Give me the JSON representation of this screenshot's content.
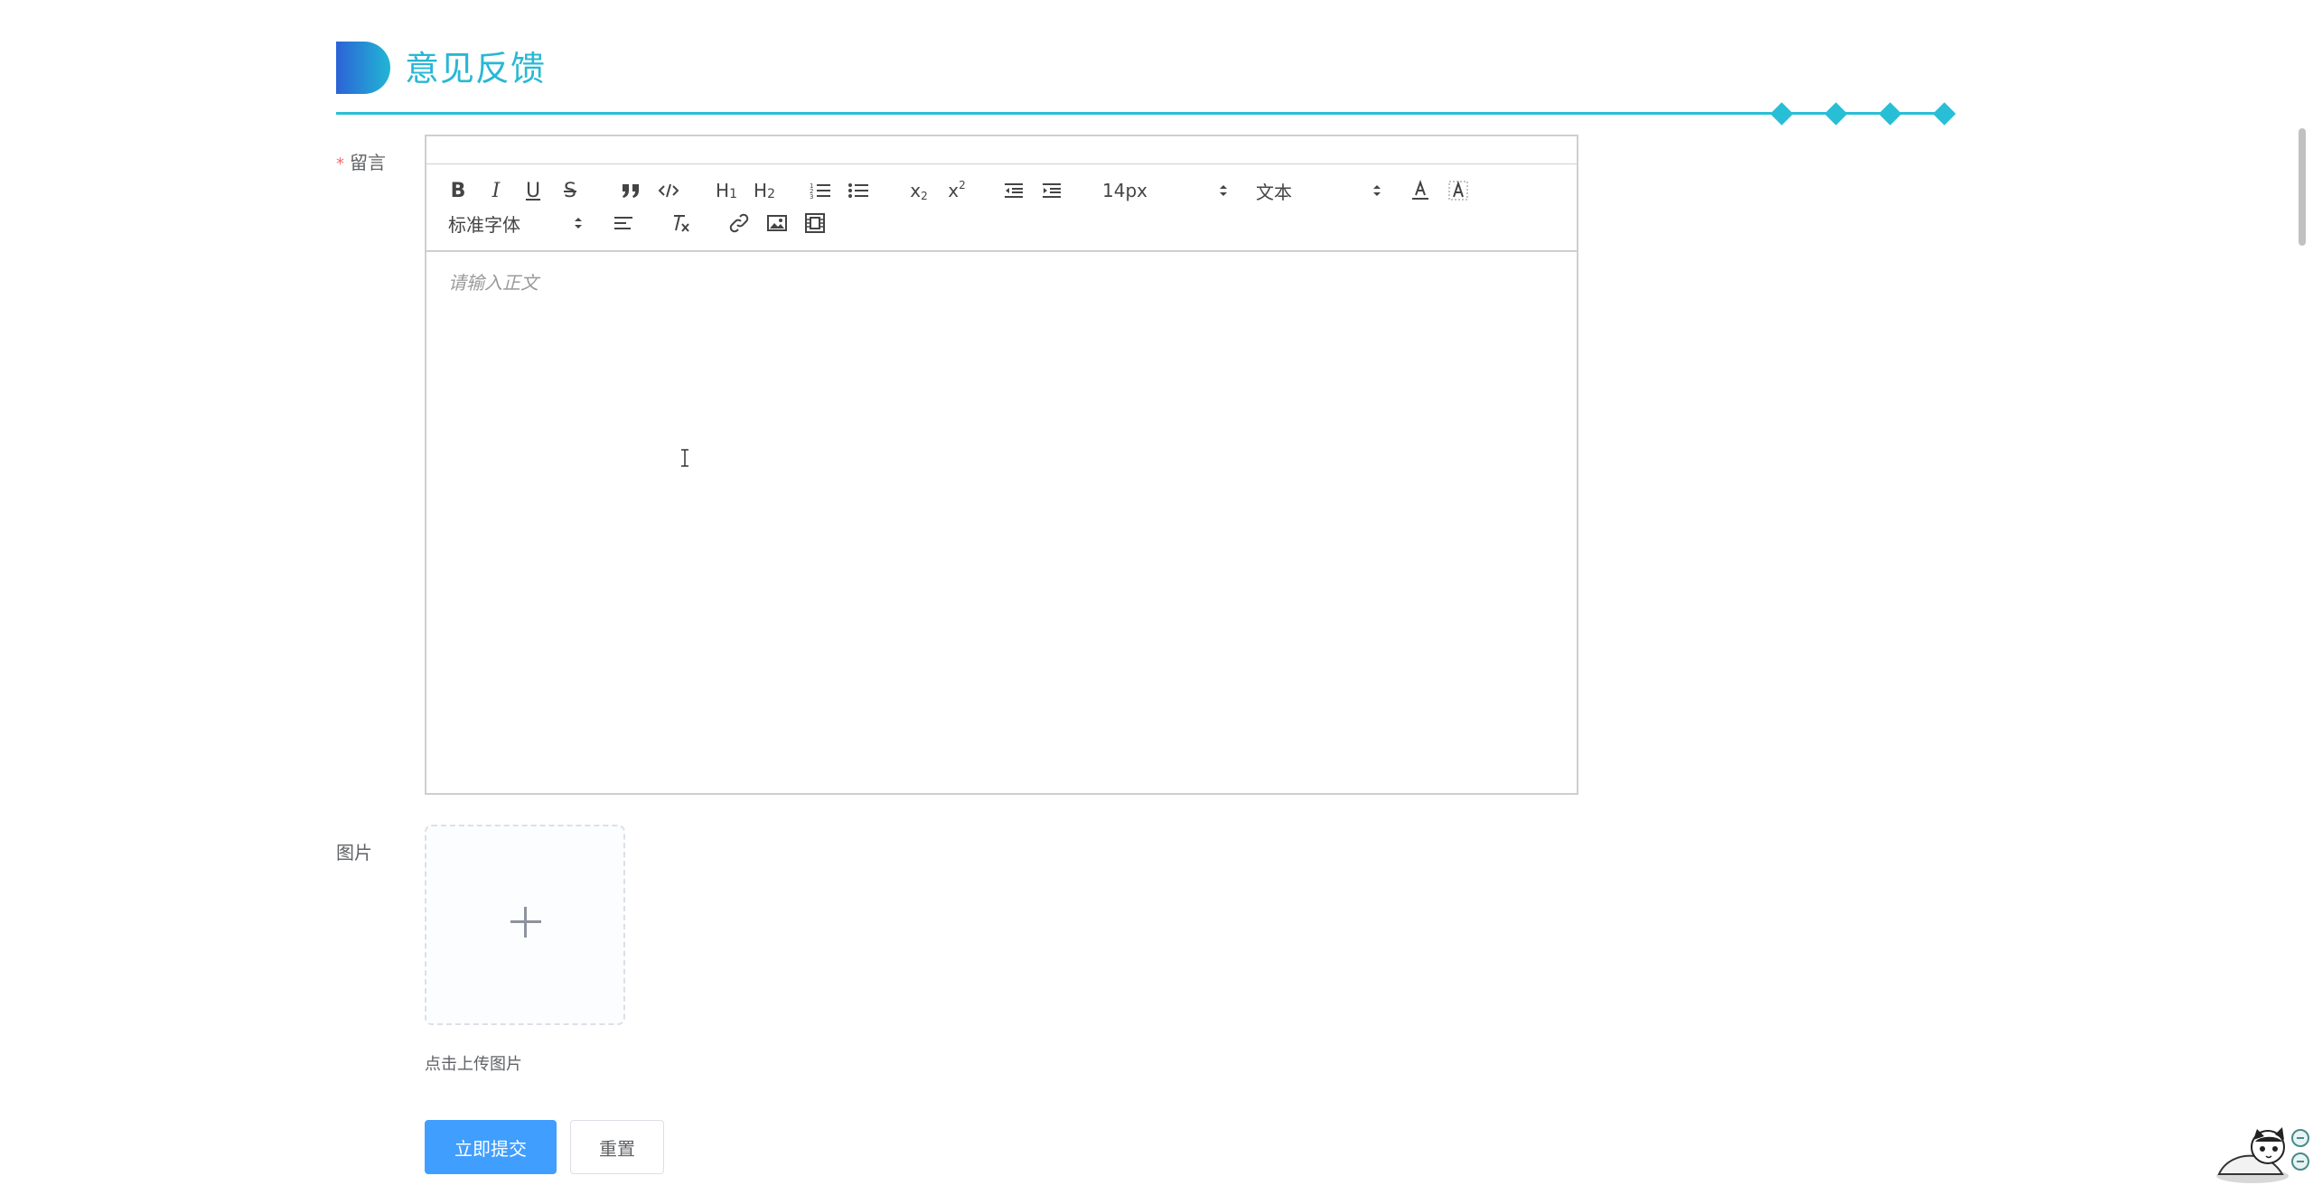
{
  "header": {
    "title": "意见反馈"
  },
  "form": {
    "message_label": "留言",
    "required_mark": "*",
    "image_label": "图片"
  },
  "editor": {
    "font_size_value": "14px",
    "heading_select_value": "文本",
    "font_family_value": "标准字体",
    "placeholder": "请输入正文",
    "toolbar_icons": [
      "bold-icon",
      "italic-icon",
      "underline-icon",
      "strikethrough-icon",
      "blockquote-icon",
      "code-block-icon",
      "header-1-icon",
      "header-2-icon",
      "ordered-list-icon",
      "bullet-list-icon",
      "subscript-icon",
      "superscript-icon",
      "outdent-icon",
      "indent-icon",
      "font-color-icon",
      "background-color-icon",
      "align-icon",
      "clear-format-icon",
      "link-icon",
      "image-icon",
      "video-icon"
    ]
  },
  "upload": {
    "tip": "点击上传图片"
  },
  "actions": {
    "submit_label": "立即提交",
    "reset_label": "重置"
  },
  "colors": {
    "accent": "#28b8d4",
    "primary_button": "#409eff",
    "required": "#f56c6c"
  }
}
